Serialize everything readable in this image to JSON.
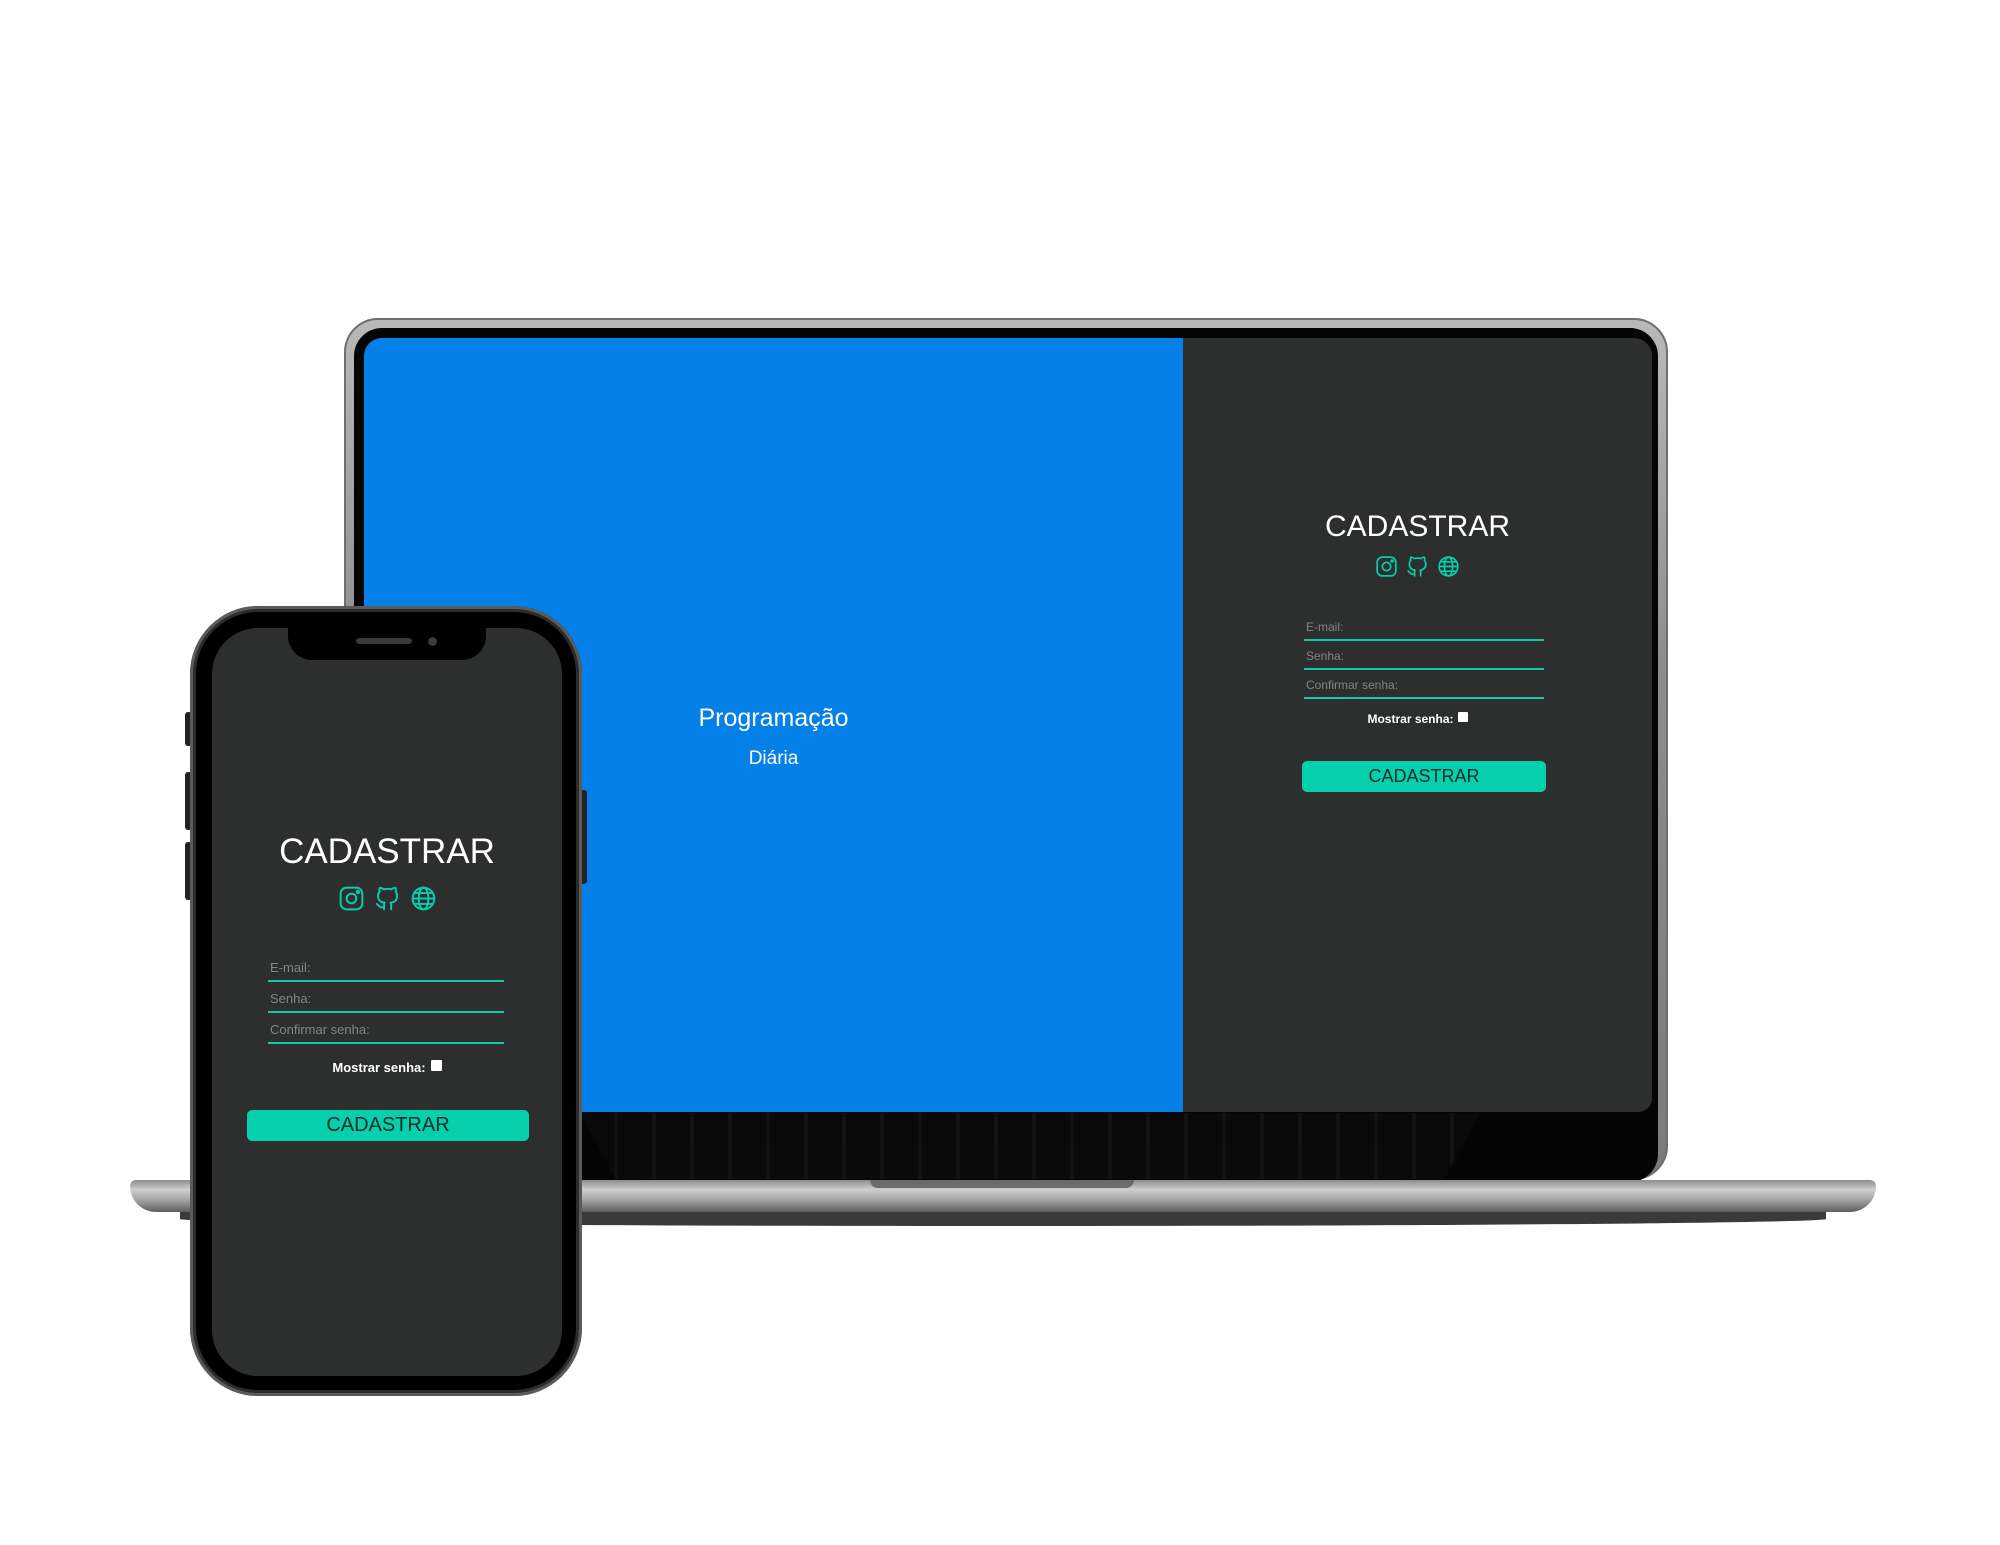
{
  "laptop": {
    "brand": {
      "title": "Programação",
      "subtitle": "Diária"
    },
    "form": {
      "title": "CADASTRAR",
      "icons": [
        "instagram-icon",
        "github-icon",
        "globe-icon"
      ],
      "email_placeholder": "E-mail:",
      "password_placeholder": "Senha:",
      "confirm_placeholder": "Confirmar senha:",
      "show_password_label": "Mostrar senha:",
      "submit_label": "CADASTRAR"
    }
  },
  "phone": {
    "form": {
      "title": "CADASTRAR",
      "icons": [
        "instagram-icon",
        "github-icon",
        "globe-icon"
      ],
      "email_placeholder": "E-mail:",
      "password_placeholder": "Senha:",
      "confirm_placeholder": "Confirmar senha:",
      "show_password_label": "Mostrar senha:",
      "submit_label": "CADASTRAR"
    }
  },
  "colors": {
    "brand_blue": "#0480e8",
    "panel_dark": "#2d2e2e",
    "accent_teal": "#06cfae",
    "field_line": "#14c9a8"
  }
}
